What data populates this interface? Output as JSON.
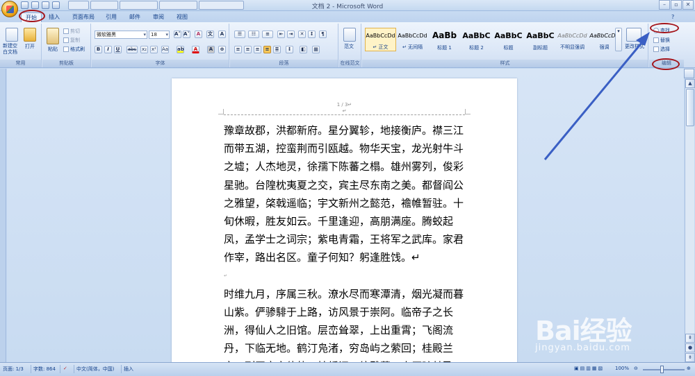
{
  "window": {
    "title": "文档 2 - Microsoft Word",
    "controls": [
      "–",
      "▫",
      "✕"
    ]
  },
  "tabs": [
    "开始",
    "插入",
    "页面布局",
    "引用",
    "邮件",
    "审阅",
    "视图"
  ],
  "ribbon": {
    "groups": {
      "clipboard": "剪贴板",
      "font": "字体",
      "paragraph": "段落",
      "online": "在线范文",
      "styles": "样式",
      "editing": "编辑",
      "common": "常用"
    },
    "common": {
      "new_doc": "新建空\n白文档",
      "open": "打开"
    },
    "clipboard": {
      "paste": "粘贴",
      "cut": "剪切",
      "copy": "复制",
      "format_painter": "格式刷"
    },
    "font": {
      "name": "微软雅黑",
      "size": "18",
      "bold": "B",
      "italic": "I",
      "underline": "U",
      "strike": "abc",
      "subscript": "x₂",
      "superscript": "x²",
      "change_case": "Aa",
      "font_color": "A",
      "grow": "A˄",
      "shrink": "A˅",
      "clear": "A",
      "phonetic": "文",
      "border_char": "A"
    },
    "online": {
      "label": "范文"
    },
    "styles": {
      "items": [
        {
          "preview": "AaBbCcDd",
          "name": "↵ 正文",
          "kind": "normal"
        },
        {
          "preview": "AaBbCcDd",
          "name": "↵ 无间隔",
          "kind": "normal"
        },
        {
          "preview": "AaBb",
          "name": "标题 1",
          "kind": "large"
        },
        {
          "preview": "AaBbC",
          "name": "标题 2",
          "kind": "mid"
        },
        {
          "preview": "AaBbC",
          "name": "标题",
          "kind": "mid"
        },
        {
          "preview": "AaBbC",
          "name": "副标题",
          "kind": "mid"
        },
        {
          "preview": "AaBbCcDd",
          "name": "不明显强调",
          "kind": "normal"
        },
        {
          "preview": "AaBbCcDd",
          "name": "强调",
          "kind": "normal"
        }
      ],
      "change_styles": "更改样式"
    },
    "editing": {
      "find": "查找",
      "replace": "替换",
      "select": "选择"
    }
  },
  "document": {
    "page_header": "1 / 3↵",
    "header_mark": "↵",
    "paragraphs": [
      "豫章故郡，洪都新府。星分翼轸，地接衡庐。襟三江而带五湖，控蛮荆而引瓯越。物华天宝，龙光射牛斗之墟；人杰地灵，徐孺下陈蕃之榻。雄州雾列，俊彩星驰。台隍枕夷夏之交，宾主尽东南之美。都督阎公之雅望，棨戟遥临；宇文新州之懿范，襜帷暂驻。十旬休暇，胜友如云。千里逢迎，高朋满座。腾蛟起凤，孟学士之词宗；紫电青霜，王将军之武库。家君作宰，路出名区。童子何知？躬逢胜饯。↵",
      "时维九月，序属三秋。潦水尽而寒潭清，烟光凝而暮山紫。俨骖騑于上路，访风景于崇阿。临帝子之长洲，得仙人之旧馆。层峦耸翠，上出重霄；飞阁流丹，下临无地。鹤汀凫渚，穷岛屿之萦回；桂殿兰宫，列冈峦之体势。披绣闼，俯雕甍，山原旷其盈视，川泽纡"
    ],
    "spacer_mark": "↵"
  },
  "status": {
    "page": "页面: 1/3",
    "words": "字数: 864",
    "language": "中文(简体，中国)",
    "insert": "插入",
    "zoom": "100%"
  },
  "watermark": {
    "brand": "Bai经验",
    "url": "jingyan.baidu.com"
  },
  "colors": {
    "annotation_red": "#a4141a",
    "annotation_arrow": "#3a5fc4"
  }
}
